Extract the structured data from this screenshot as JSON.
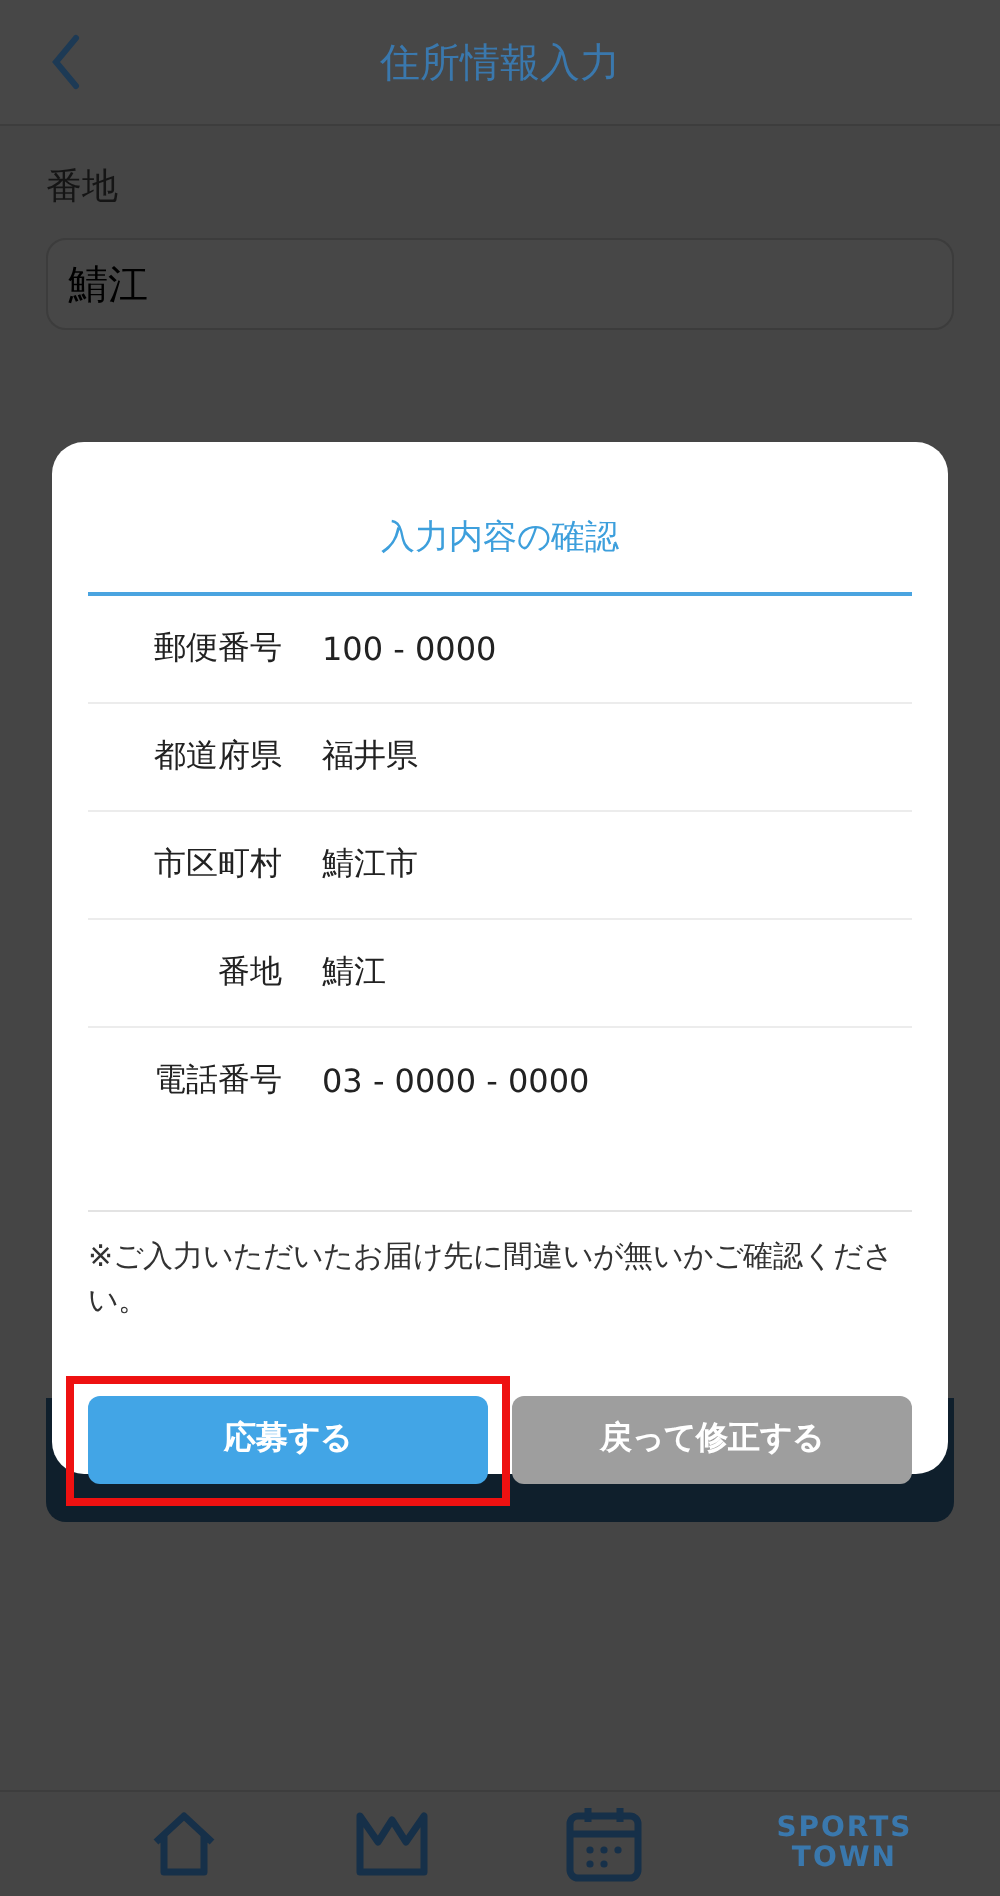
{
  "header": {
    "title": "住所情報入力"
  },
  "form": {
    "label": "番地",
    "value": "鯖江"
  },
  "dialog": {
    "title": "入力内容の確認",
    "rows": [
      {
        "label": "郵便番号",
        "value": "100 - 0000"
      },
      {
        "label": "都道府県",
        "value": "福井県"
      },
      {
        "label": "市区町村",
        "value": "鯖江市"
      },
      {
        "label": "番地",
        "value": "鯖江"
      },
      {
        "label": "電話番号",
        "value": "03 - 0000 - 0000"
      }
    ],
    "note": "※ご入力いただいたお届け先に間違いが無いかご確認ください。",
    "buttons": [
      {
        "label": "応募する",
        "kind": "primary",
        "highlighted": true
      },
      {
        "label": "戻って修正する",
        "kind": "secondary",
        "highlighted": false
      }
    ]
  },
  "tab_bar": [
    {
      "kind": "home"
    },
    {
      "kind": "crown"
    },
    {
      "kind": "calendar"
    },
    {
      "kind": "logo",
      "lines": [
        "SPORTS",
        "TOWN"
      ]
    }
  ]
}
